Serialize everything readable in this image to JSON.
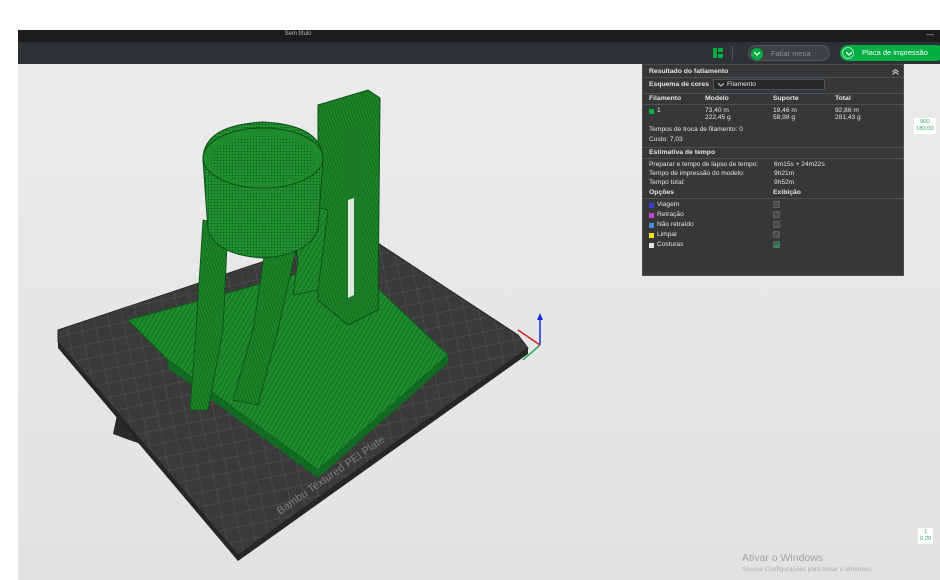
{
  "window": {
    "title": "Sem título",
    "minimize_glyph": "—"
  },
  "toolbar": {
    "layout_icon": "layout-grid-icon",
    "slice_label": "Fatiar mesa",
    "print_label": "Placa de impressão"
  },
  "stats": {
    "title": "Resultado do fatiamento",
    "color_scheme_label": "Esquema de cores",
    "color_scheme_value": "Filamento",
    "columns": [
      "Filamento",
      "Modelo",
      "Suporte",
      "Total"
    ],
    "row": {
      "id": "1",
      "swatch": "#00ae42",
      "model_length": "73,40 m",
      "model_weight": "222,45 g",
      "support_length": "19,46 m",
      "support_weight": "58,98 g",
      "total_length": "92,86 m",
      "total_weight": "281,43 g"
    },
    "filament_changes": "Tempos de troca de filamento:  0",
    "cost": "Custo:  7,03",
    "time_title": "Estimativa de tempo",
    "prepare_label": "Preparar e tempo de lapso de tempo:",
    "prepare_value": "6m15s + 24m22s",
    "print_time_label": "Tempo de impressão do modelo:",
    "print_time_value": "9h21m",
    "total_time_label": "Tempo total:",
    "total_time_value": "9h52m",
    "options_label": "Opções",
    "display_label": "Exibição",
    "options": [
      {
        "label": "Viagem",
        "color": "#3b3fd0"
      },
      {
        "label": "Retração",
        "color": "#c73bd6"
      },
      {
        "label": "Não retraído",
        "color": "#4d8fd8"
      },
      {
        "label": "Limpar",
        "color": "#f2e600"
      },
      {
        "label": "Costuras",
        "color": "#e6e6e6"
      }
    ]
  },
  "plate_label": "Bambu Textured PEI Plate",
  "layer_slider": {
    "top_line1": "900",
    "top_line2": "180,00",
    "bottom_line1": "1",
    "bottom_line2": "0,20"
  },
  "watermark": {
    "title": "Ativar o Windows",
    "subtitle": "Acesse Configurações para ativar o Windows."
  }
}
